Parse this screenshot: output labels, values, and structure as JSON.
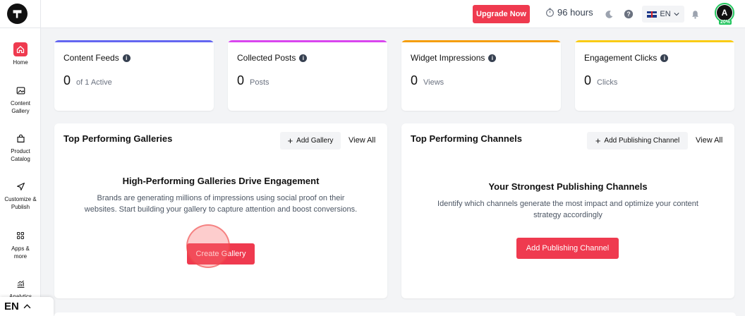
{
  "topbar": {
    "upgrade_label": "Upgrade Now",
    "hours": "96 hours",
    "language": "EN",
    "avatar_letter": "A",
    "avatar_progress": "20%",
    "accent": "#ef3a4f"
  },
  "sidebar": {
    "items": [
      {
        "label": "Home",
        "icon": "home-icon"
      },
      {
        "label": "Content Gallery",
        "icon": "image-icon"
      },
      {
        "label": "Product Catalog",
        "icon": "shopping-bag-icon"
      },
      {
        "label": "Customize & Publish",
        "icon": "send-icon"
      },
      {
        "label": "Apps & more",
        "icon": "apps-grid-icon"
      },
      {
        "label": "Analytics",
        "icon": "analytics-icon"
      }
    ],
    "language_footer": "EN"
  },
  "stats": [
    {
      "title": "Content Feeds",
      "value": "0",
      "sub": "of 1 Active",
      "color": "#6366f1"
    },
    {
      "title": "Collected Posts",
      "value": "0",
      "sub": "Posts",
      "color": "#d946ef"
    },
    {
      "title": "Widget Impressions",
      "value": "0",
      "sub": "Views",
      "color": "#f59e0b"
    },
    {
      "title": "Engagement Clicks",
      "value": "0",
      "sub": "Clicks",
      "color": "#facc15"
    }
  ],
  "galleries": {
    "title": "Top Performing Galleries",
    "add_label": "Add Gallery",
    "view_all": "View All",
    "heading": "High-Performing Galleries Drive Engagement",
    "description": "Brands are generating millions of impressions using social proof on their websites. Start building your gallery to capture attention and boost conversions.",
    "cta": "Create Gallery"
  },
  "channels": {
    "title": "Top Performing Channels",
    "add_label": "Add Publishing Channel",
    "view_all": "View All",
    "heading": "Your Strongest Publishing Channels",
    "description": "Identify which channels generate the most impact and optimize your content strategy accordingly",
    "cta": "Add Publishing Channel"
  }
}
